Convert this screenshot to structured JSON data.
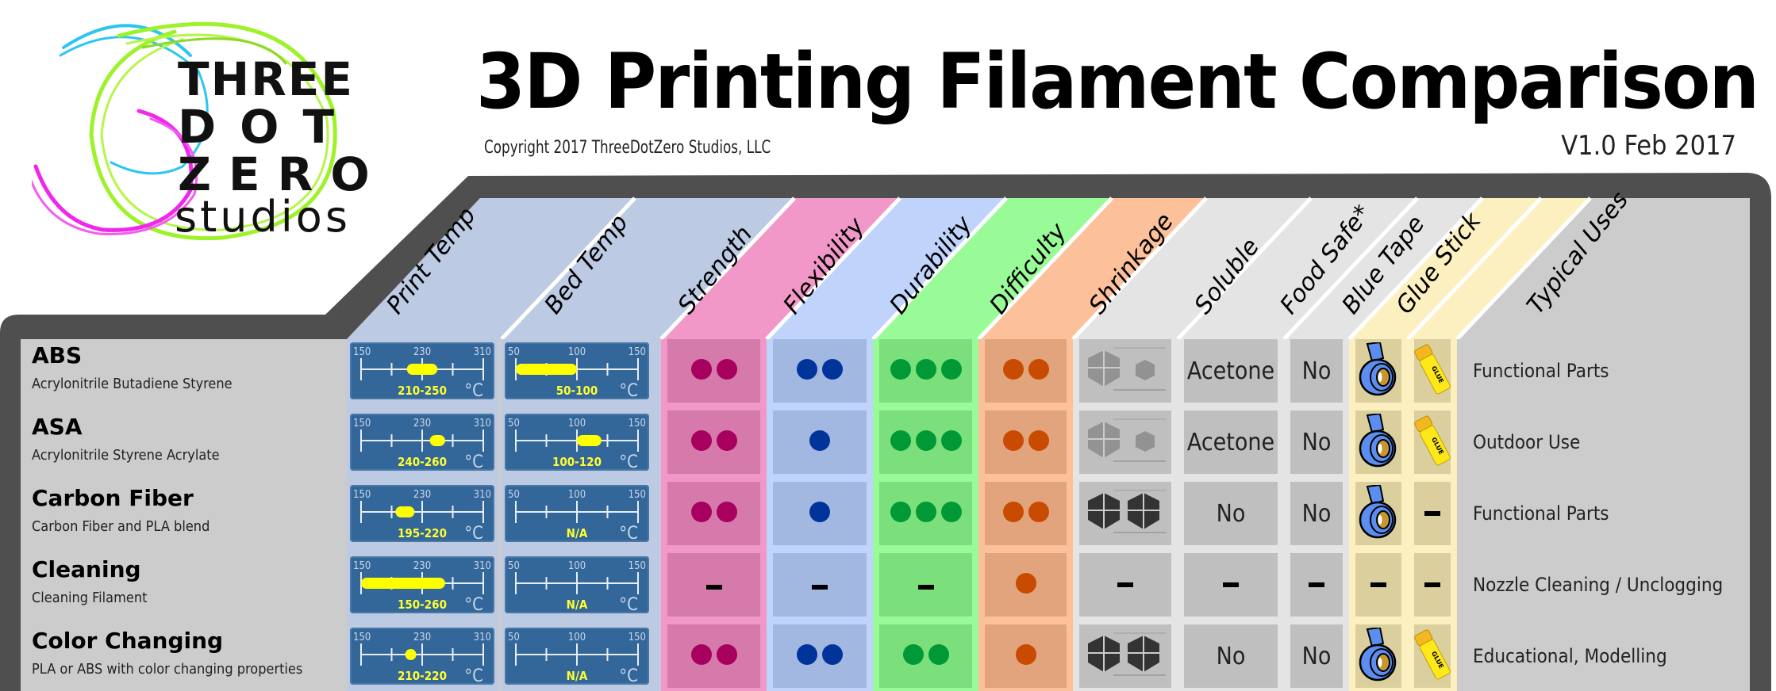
{
  "header": {
    "logo": {
      "line1": "THREE",
      "line2": "DOT",
      "line3": "ZERO",
      "line4": "studios"
    },
    "title": "3D Printing Filament Comparison",
    "copyright": "Copyright 2017 ThreeDotZero Studios, LLC",
    "version": "V1.0 Feb 2017"
  },
  "columns": [
    {
      "key": "print_temp",
      "label": "Print Temp",
      "color": "#bccae3"
    },
    {
      "key": "bed_temp",
      "label": "Bed Temp",
      "color": "#bccae3"
    },
    {
      "key": "strength",
      "label": "Strength",
      "color": "#f198c8",
      "cell_color": "#d57aab",
      "dot_color": "#a8005f"
    },
    {
      "key": "flexibility",
      "label": "Flexibility",
      "color": "#bfd3fb",
      "cell_color": "#a2b8e0",
      "dot_color": "#00349b"
    },
    {
      "key": "durability",
      "label": "Durability",
      "color": "#99fb98",
      "cell_color": "#7be07b",
      "dot_color": "#009935"
    },
    {
      "key": "difficulty",
      "label": "Difficulty",
      "color": "#fcc19a",
      "cell_color": "#e1a47d",
      "dot_color": "#c94a01"
    },
    {
      "key": "shrinkage",
      "label": "Shrinkage",
      "color": "#e4e4e4"
    },
    {
      "key": "soluble",
      "label": "Soluble",
      "color": "#e4e4e4"
    },
    {
      "key": "food_safe",
      "label": "Food Safe*",
      "color": "#e4e4e4"
    },
    {
      "key": "blue_tape",
      "label": "Blue Tape",
      "color": "#fdf0c0"
    },
    {
      "key": "glue_stick",
      "label": "Glue Stick",
      "color": "#fdf0c0"
    },
    {
      "key": "typical_uses",
      "label": "Typical Uses",
      "color": "#cccccc"
    }
  ],
  "gauges": {
    "print_temp": {
      "min": 150,
      "mid": 230,
      "max": 310,
      "unit": "°C"
    },
    "bed_temp": {
      "min": 50,
      "mid": 100,
      "max": 150,
      "unit": "°C"
    }
  },
  "colors": {
    "frame": "#4f4f4f",
    "gauge_bg": "#336699",
    "gauge_bar": "#ffff00"
  },
  "rows": [
    {
      "name": "ABS",
      "desc": "Acrylonitrile Butadiene Styrene",
      "print_temp": {
        "label": "210-250",
        "low": 210,
        "high": 250
      },
      "bed_temp": {
        "label": "50-100",
        "low": 50,
        "high": 100
      },
      "strength": 2,
      "flexibility": 2,
      "durability": 3,
      "difficulty": 2,
      "shrinkage": "high",
      "soluble": "Acetone",
      "food_safe": "No",
      "blue_tape": "yes",
      "glue_stick": "yes",
      "typical_uses": "Functional Parts"
    },
    {
      "name": "ASA",
      "desc": "Acrylonitrile Styrene Acrylate",
      "print_temp": {
        "label": "240-260",
        "low": 240,
        "high": 260
      },
      "bed_temp": {
        "label": "100-120",
        "low": 100,
        "high": 120
      },
      "strength": 2,
      "flexibility": 1,
      "durability": 3,
      "difficulty": 2,
      "shrinkage": "high",
      "soluble": "Acetone",
      "food_safe": "No",
      "blue_tape": "yes",
      "glue_stick": "yes",
      "typical_uses": "Outdoor Use"
    },
    {
      "name": "Carbon Fiber",
      "desc": "Carbon Fiber and PLA blend",
      "print_temp": {
        "label": "195-220",
        "low": 195,
        "high": 220
      },
      "bed_temp": {
        "label": "N/A",
        "low": null,
        "high": null
      },
      "strength": 2,
      "flexibility": 1,
      "durability": 3,
      "difficulty": 2,
      "shrinkage": "low",
      "soluble": "No",
      "food_safe": "No",
      "blue_tape": "yes",
      "glue_stick": "-",
      "typical_uses": "Functional Parts"
    },
    {
      "name": "Cleaning",
      "desc": "Cleaning Filament",
      "print_temp": {
        "label": "150-260",
        "low": 150,
        "high": 260
      },
      "bed_temp": {
        "label": "N/A",
        "low": null,
        "high": null
      },
      "strength": "-",
      "flexibility": "-",
      "durability": "-",
      "difficulty": 1,
      "shrinkage": "-",
      "soluble": "-",
      "food_safe": "-",
      "blue_tape": "-",
      "glue_stick": "-",
      "typical_uses": "Nozzle Cleaning / Unclogging"
    },
    {
      "name": "Color Changing",
      "desc": "PLA or ABS with color changing properties",
      "print_temp": {
        "label": "210-220",
        "low": 210,
        "high": 220
      },
      "bed_temp": {
        "label": "N/A",
        "low": null,
        "high": null
      },
      "strength": 2,
      "flexibility": 2,
      "durability": 2,
      "difficulty": 1,
      "shrinkage": "low",
      "soluble": "No",
      "food_safe": "No",
      "blue_tape": "yes",
      "glue_stick": "yes",
      "typical_uses": "Educational, Modelling"
    }
  ]
}
